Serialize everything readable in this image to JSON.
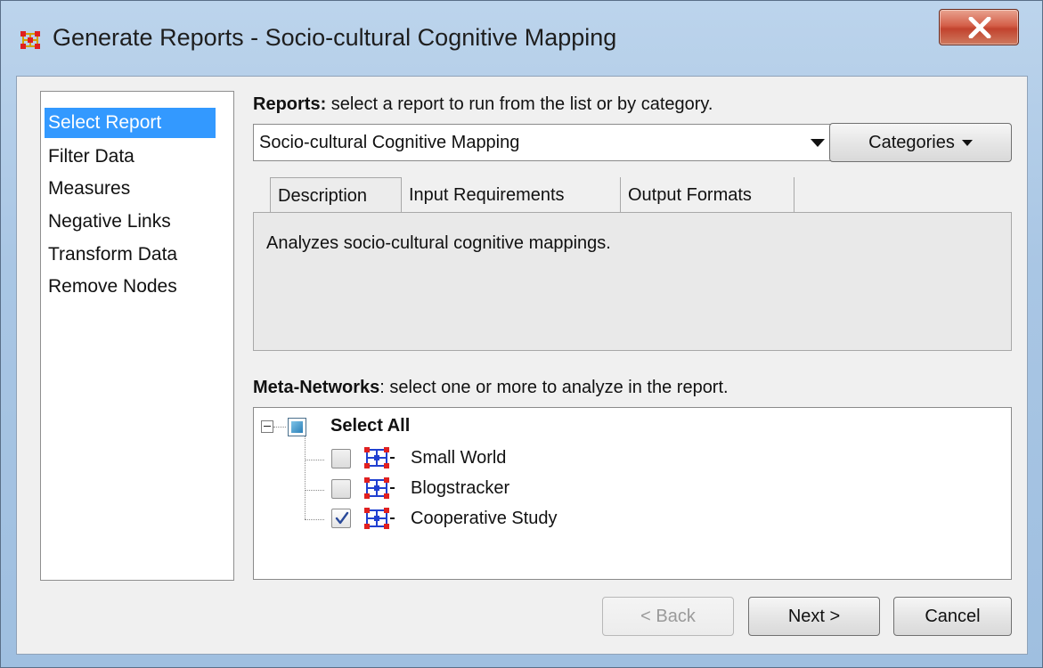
{
  "window": {
    "title": "Generate Reports - Socio-cultural Cognitive Mapping",
    "close_glyph": "X"
  },
  "nav": {
    "items": [
      {
        "label": "Select Report",
        "selected": true
      },
      {
        "label": "Filter Data",
        "selected": false
      },
      {
        "label": "Measures",
        "selected": false
      },
      {
        "label": "Negative Links",
        "selected": false
      },
      {
        "label": "Transform Data",
        "selected": false
      },
      {
        "label": "Remove Nodes",
        "selected": false
      }
    ]
  },
  "reports": {
    "label_bold": "Reports:",
    "label_rest": " select a report to run from the list or by category.",
    "selected": "Socio-cultural Cognitive Mapping",
    "categories_label": "Categories"
  },
  "tabs": {
    "items": [
      {
        "label": "Description",
        "active": true
      },
      {
        "label": "Input Requirements",
        "active": false
      },
      {
        "label": "Output Formats",
        "active": false
      }
    ],
    "description_text": "Analyzes socio-cultural cognitive mappings."
  },
  "meta": {
    "label_bold": "Meta-Networks",
    "label_rest": ": select one or more to analyze in the report.",
    "select_all": "Select All",
    "networks": [
      {
        "name": "Small World",
        "checked": false
      },
      {
        "name": "Blogstracker",
        "checked": false
      },
      {
        "name": "Cooperative Study",
        "checked": true
      }
    ]
  },
  "footer": {
    "back_label": "< Back",
    "next_label": "Next >",
    "cancel_label": "Cancel"
  },
  "colors": {
    "selection": "#3399ff",
    "close_button": "#c2432e",
    "network_icon_nodes": "#e02020",
    "network_icon_links": "#2040d0"
  }
}
